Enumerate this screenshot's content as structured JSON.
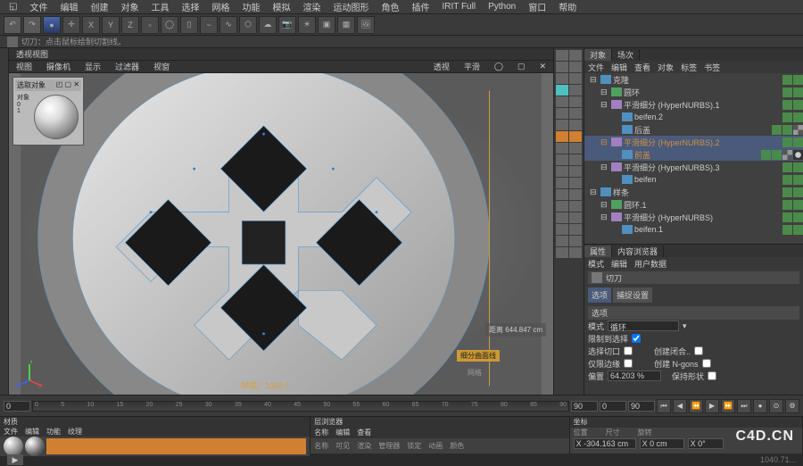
{
  "menu": [
    "文件",
    "编辑",
    "创建",
    "对象",
    "工具",
    "选择",
    "网格",
    "功能",
    "模拟",
    "渲染",
    "运动图形",
    "角色",
    "插件",
    "IRIT Full",
    "Python",
    "窗口",
    "帮助"
  ],
  "toolbar_icons": [
    "undo",
    "redo",
    "live",
    "axis",
    "x",
    "y",
    "z",
    "cube",
    "sphere",
    "cyl",
    "spline",
    "nurbs",
    "deform",
    "env",
    "cam",
    "light",
    "render",
    "rv",
    "pic"
  ],
  "infobar": {
    "icon_name": "knife-icon",
    "text": "切刀：点击鼠标绘制切割线。"
  },
  "vp_title": "透视视图",
  "vp_tabs": [
    "视图",
    "摄像机",
    "显示",
    "过滤器",
    "视窗"
  ],
  "vp_right": [
    "透视",
    "平滑",
    "◯",
    "▢",
    "✕"
  ],
  "mat_prev": {
    "title": "选取对象",
    "count_label": "对象",
    "count": "0",
    "pts": "1"
  },
  "vp": {
    "distance": "距离",
    "dist_val": "644.847 cm",
    "toggle": "细分曲面线",
    "grid": "网格",
    "frame": "帧幅：",
    "frame_val": "1082-1"
  },
  "palette_rows": 18,
  "obj_tabs": [
    "对象",
    "场次"
  ],
  "obj_menu": [
    "文件",
    "编辑",
    "查看",
    "对象",
    "标签",
    "书签"
  ],
  "tree": [
    {
      "lvl": 0,
      "type": "cube",
      "name": "克隆",
      "tags": [
        "green",
        "green"
      ]
    },
    {
      "lvl": 1,
      "type": "torus",
      "name": "圆环",
      "tags": [
        "green",
        "green"
      ]
    },
    {
      "lvl": 1,
      "type": "hyper",
      "name": "平滑细分 (HyperNURBS).1",
      "tags": [
        "green",
        "green"
      ]
    },
    {
      "lvl": 2,
      "type": "cube",
      "name": "beifen.2",
      "tags": [
        "green",
        "green"
      ]
    },
    {
      "lvl": 2,
      "type": "cube",
      "name": "后盖",
      "tags": [
        "green",
        "green",
        "checker"
      ]
    },
    {
      "lvl": 1,
      "type": "hyper",
      "name": "平滑细分 (HyperNURBS).2",
      "sel": true,
      "tags": [
        "green",
        "green"
      ]
    },
    {
      "lvl": 2,
      "type": "cube",
      "name": "前盖",
      "sel": true,
      "tags": [
        "green",
        "green",
        "checker",
        "dot"
      ]
    },
    {
      "lvl": 1,
      "type": "hyper",
      "name": "平滑细分 (HyperNURBS).3",
      "tags": [
        "green",
        "green"
      ]
    },
    {
      "lvl": 2,
      "type": "cube",
      "name": "beifen",
      "tags": [
        "green",
        "green"
      ]
    },
    {
      "lvl": 0,
      "type": "cube",
      "name": "样条",
      "tags": [
        "green",
        "green"
      ]
    },
    {
      "lvl": 1,
      "type": "torus",
      "name": "圆环.1",
      "tags": [
        "green",
        "green"
      ]
    },
    {
      "lvl": 1,
      "type": "hyper",
      "name": "平滑细分 (HyperNURBS)",
      "tags": [
        "green",
        "green"
      ]
    },
    {
      "lvl": 2,
      "type": "cube",
      "name": "beifen.1",
      "tags": [
        "green",
        "green"
      ]
    }
  ],
  "attr_tabs": [
    "属性",
    "内容浏览器"
  ],
  "attr_menu": [
    "模式",
    "编辑",
    "用户数据"
  ],
  "attr": {
    "tool": "切刀",
    "sections": [
      "选项",
      "捕捉设置"
    ],
    "group": "选项",
    "mode_label": "模式",
    "mode_val": "循环",
    "rows": [
      {
        "label": "限制到选择",
        "checked": true
      },
      {
        "label": "选择切口",
        "checked": false,
        "label2": "创建闭合..",
        "checked2": false
      },
      {
        "label": "仅限边缘",
        "checked": false,
        "label2": "创建 N-gons",
        "checked2": false
      }
    ],
    "offset_label": "偏置",
    "offset_val": "64.203 %",
    "preserve": "保持形状"
  },
  "timeline": {
    "start": "0",
    "ticks": [
      "0",
      "5",
      "10",
      "15",
      "20",
      "25",
      "30",
      "35",
      "40",
      "45",
      "50",
      "55",
      "60",
      "65",
      "70",
      "75",
      "80",
      "85",
      "90"
    ],
    "end": "90",
    "range_a": "0",
    "range_b": "90"
  },
  "bottom": {
    "mat_tabs": [
      "材质"
    ],
    "mat_menu": [
      "文件",
      "编辑",
      "功能",
      "纹理"
    ],
    "obj_tabs": [
      "层浏览器"
    ],
    "obj_menu": [
      "名称",
      "编辑",
      "查看"
    ],
    "obj_cols": [
      "名称",
      "可见",
      "渲染",
      "管理器",
      "锁定",
      "动画",
      "颜色"
    ],
    "coord_tabs": [
      "坐标"
    ],
    "coord_head": [
      "位置",
      "尺寸",
      "旋转"
    ],
    "coord": {
      "x": "X -304.163 cm",
      "sx": "X 0 cm",
      "rx": "X 0°"
    }
  },
  "footer": {
    "pos": "1040.71..."
  },
  "watermark": "C4D.CN"
}
